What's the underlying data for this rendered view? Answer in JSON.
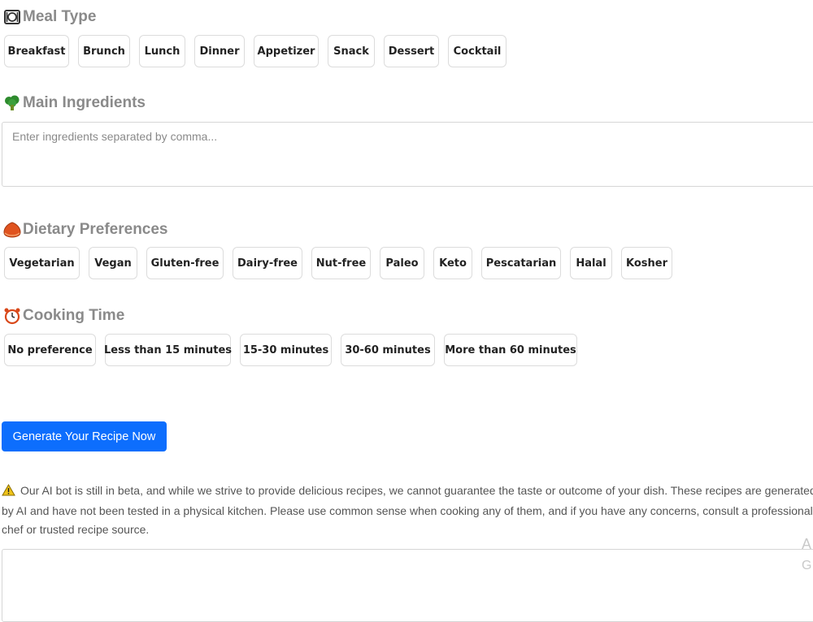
{
  "meal_type": {
    "title": "Meal Type",
    "icon": "plate-cutlery-icon",
    "options": [
      "Breakfast",
      "Brunch",
      "Lunch",
      "Dinner",
      "Appetizer",
      "Snack",
      "Dessert",
      "Cocktail"
    ]
  },
  "ingredients": {
    "title": "Main Ingredients",
    "icon": "broccoli-icon",
    "placeholder": "Enter ingredients separated by comma..."
  },
  "dietary": {
    "title": "Dietary Preferences",
    "icon": "chestnut-icon",
    "options": [
      "Vegetarian",
      "Vegan",
      "Gluten-free",
      "Dairy-free",
      "Nut-free",
      "Paleo",
      "Keto",
      "Pescatarian",
      "Halal",
      "Kosher"
    ]
  },
  "cooking_time": {
    "title": "Cooking Time",
    "icon": "alarm-clock-icon",
    "options": [
      "No preference",
      "Less than 15 minutes",
      "15-30 minutes",
      "30-60 minutes",
      "More than 60 minutes"
    ]
  },
  "generate_button": "Generate Your Recipe Now",
  "disclaimer": "Our AI bot is still in beta, and while we strive to provide delicious recipes, we cannot guarantee the taste or outcome of your dish. These recipes are generated by AI and have not been tested in a physical kitchen. Please use common sense when cooking any of them, and if you have any concerns, consult a professional chef or trusted recipe source.",
  "clipped_text": [
    "A",
    "G"
  ],
  "colors": {
    "accent": "#0d6efd",
    "heading": "#8a8a8a",
    "warning": "#f0c419"
  }
}
